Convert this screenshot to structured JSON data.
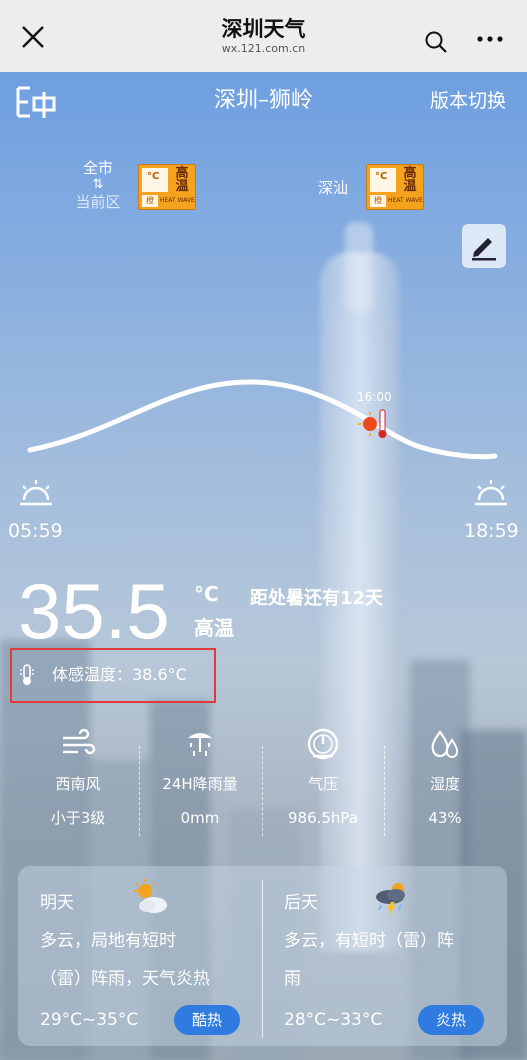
{
  "browser": {
    "title": "深圳天气",
    "url": "wx.121.com.cn"
  },
  "header": {
    "location": "深圳–狮岭",
    "version_switch": "版本切换"
  },
  "region_toggle": {
    "top": "全市",
    "arrows": "⇅",
    "bottom": "当前区"
  },
  "warnings": {
    "district": "深汕",
    "signal_text": "高温",
    "signal_color": "橙",
    "signal_sub": "HEAT WAVE",
    "signal_unit": "°C"
  },
  "sun": {
    "current_time": "16:00",
    "sunrise": "05:59",
    "sunset": "18:59"
  },
  "current": {
    "temperature": "35.5",
    "unit": "°C",
    "description": "高温",
    "countdown": "距处暑还有12天",
    "feels_like": "体感温度：38.6°C"
  },
  "stats": [
    {
      "icon": "wind-icon",
      "label": "西南风",
      "value": "小于3级"
    },
    {
      "icon": "rain-icon",
      "label": "24H降雨量",
      "value": "0mm"
    },
    {
      "icon": "pressure-gauge-icon",
      "label": "气压",
      "value": "986.5hPa"
    },
    {
      "icon": "humidity-icon",
      "label": "湿度",
      "value": "43%"
    }
  ],
  "forecast": [
    {
      "day": "明天",
      "icon": "partly-cloudy-icon",
      "desc_line1": "多云，局地有短时",
      "desc_line2": "（雷）阵雨，天气炎热",
      "range": "29°C~35°C",
      "badge": "酷热"
    },
    {
      "day": "后天",
      "icon": "thunderstorm-icon",
      "desc_line1": "多云，有短时（雷）阵",
      "desc_line2": "雨",
      "range": "28°C~33°C",
      "badge": "炎热"
    }
  ],
  "colors": {
    "badge_blue": "#2f7be0",
    "warning_orange": "#f5a31f",
    "highlight_red": "#e03b3b"
  }
}
